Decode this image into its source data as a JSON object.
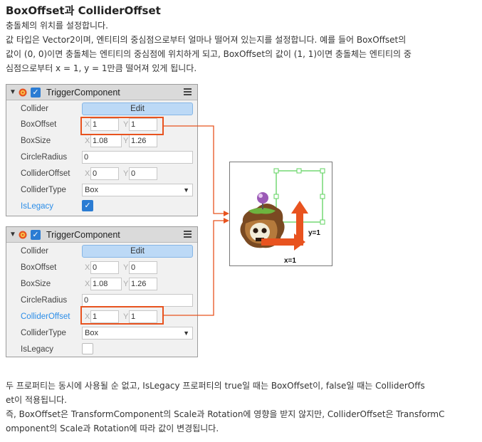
{
  "heading": "BoxOffset과 ColliderOffset",
  "paragraphs": {
    "p1_line1": "충돌체의 위치를 설정합니다.",
    "p1_line2": "값 타입은 Vector2이며, 엔티티의 중심점으로부터 얼마나 떨어져 있는지를 설정합니다. 예를 들어 BoxOffset의",
    "p1_line3": "값이 (0, 0)이면 충돌체는 엔티티의 중심점에 위치하게 되고, BoxOffset의 값이 (1, 1)이면 충돌체는 엔티티의 중",
    "p1_line4": "심점으로부터 x = 1, y = 1만큼 떨어져 있게 됩니다.",
    "p2_line1": "두 프로퍼티는 동시에 사용될 순 없고, IsLegacy 프로퍼티의 true일 때는 BoxOffset이, false일 때는 ColliderOffs",
    "p2_line2": "et이 적용됩니다.",
    "p2_line3": "즉, BoxOffset은 TransformComponent의 Scale과 Rotation에 영향을 받지 않지만, ColliderOffset은 TransformC",
    "p2_line4": "omponent의 Scale과 Rotation에 따라 값이 변경됩니다."
  },
  "panel1": {
    "title": "TriggerComponent",
    "collider_label": "Collider",
    "collider_button": "Edit",
    "boxoffset_label": "BoxOffset",
    "boxoffset_x": "1",
    "boxoffset_y": "1",
    "boxsize_label": "BoxSize",
    "boxsize_x": "1.08",
    "boxsize_y": "1.26",
    "circleradius_label": "CircleRadius",
    "circleradius": "0",
    "collideroffset_label": "ColliderOffset",
    "collideroffset_x": "0",
    "collideroffset_y": "0",
    "collidertype_label": "ColliderType",
    "collidertype": "Box",
    "islegacy_label": "IsLegacy",
    "islegacy": true
  },
  "panel2": {
    "title": "TriggerComponent",
    "collider_label": "Collider",
    "collider_button": "Edit",
    "boxoffset_label": "BoxOffset",
    "boxoffset_x": "0",
    "boxoffset_y": "0",
    "boxsize_label": "BoxSize",
    "boxsize_x": "1.08",
    "boxsize_y": "1.26",
    "circleradius_label": "CircleRadius",
    "circleradius": "0",
    "collideroffset_label": "ColliderOffset",
    "collideroffset_x": "1",
    "collideroffset_y": "1",
    "collidertype_label": "ColliderType",
    "collidertype": "Box",
    "islegacy_label": "IsLegacy",
    "islegacy": false
  },
  "axis_labels": {
    "x": "X",
    "y": "Y"
  },
  "preview": {
    "x_label": "x=1",
    "y_label": "y=1"
  },
  "colors": {
    "highlight": "#e8531f",
    "checkbox": "#2b7cd3",
    "edit_button": "#bcd9f6",
    "collider_box": "#5fd35f"
  }
}
